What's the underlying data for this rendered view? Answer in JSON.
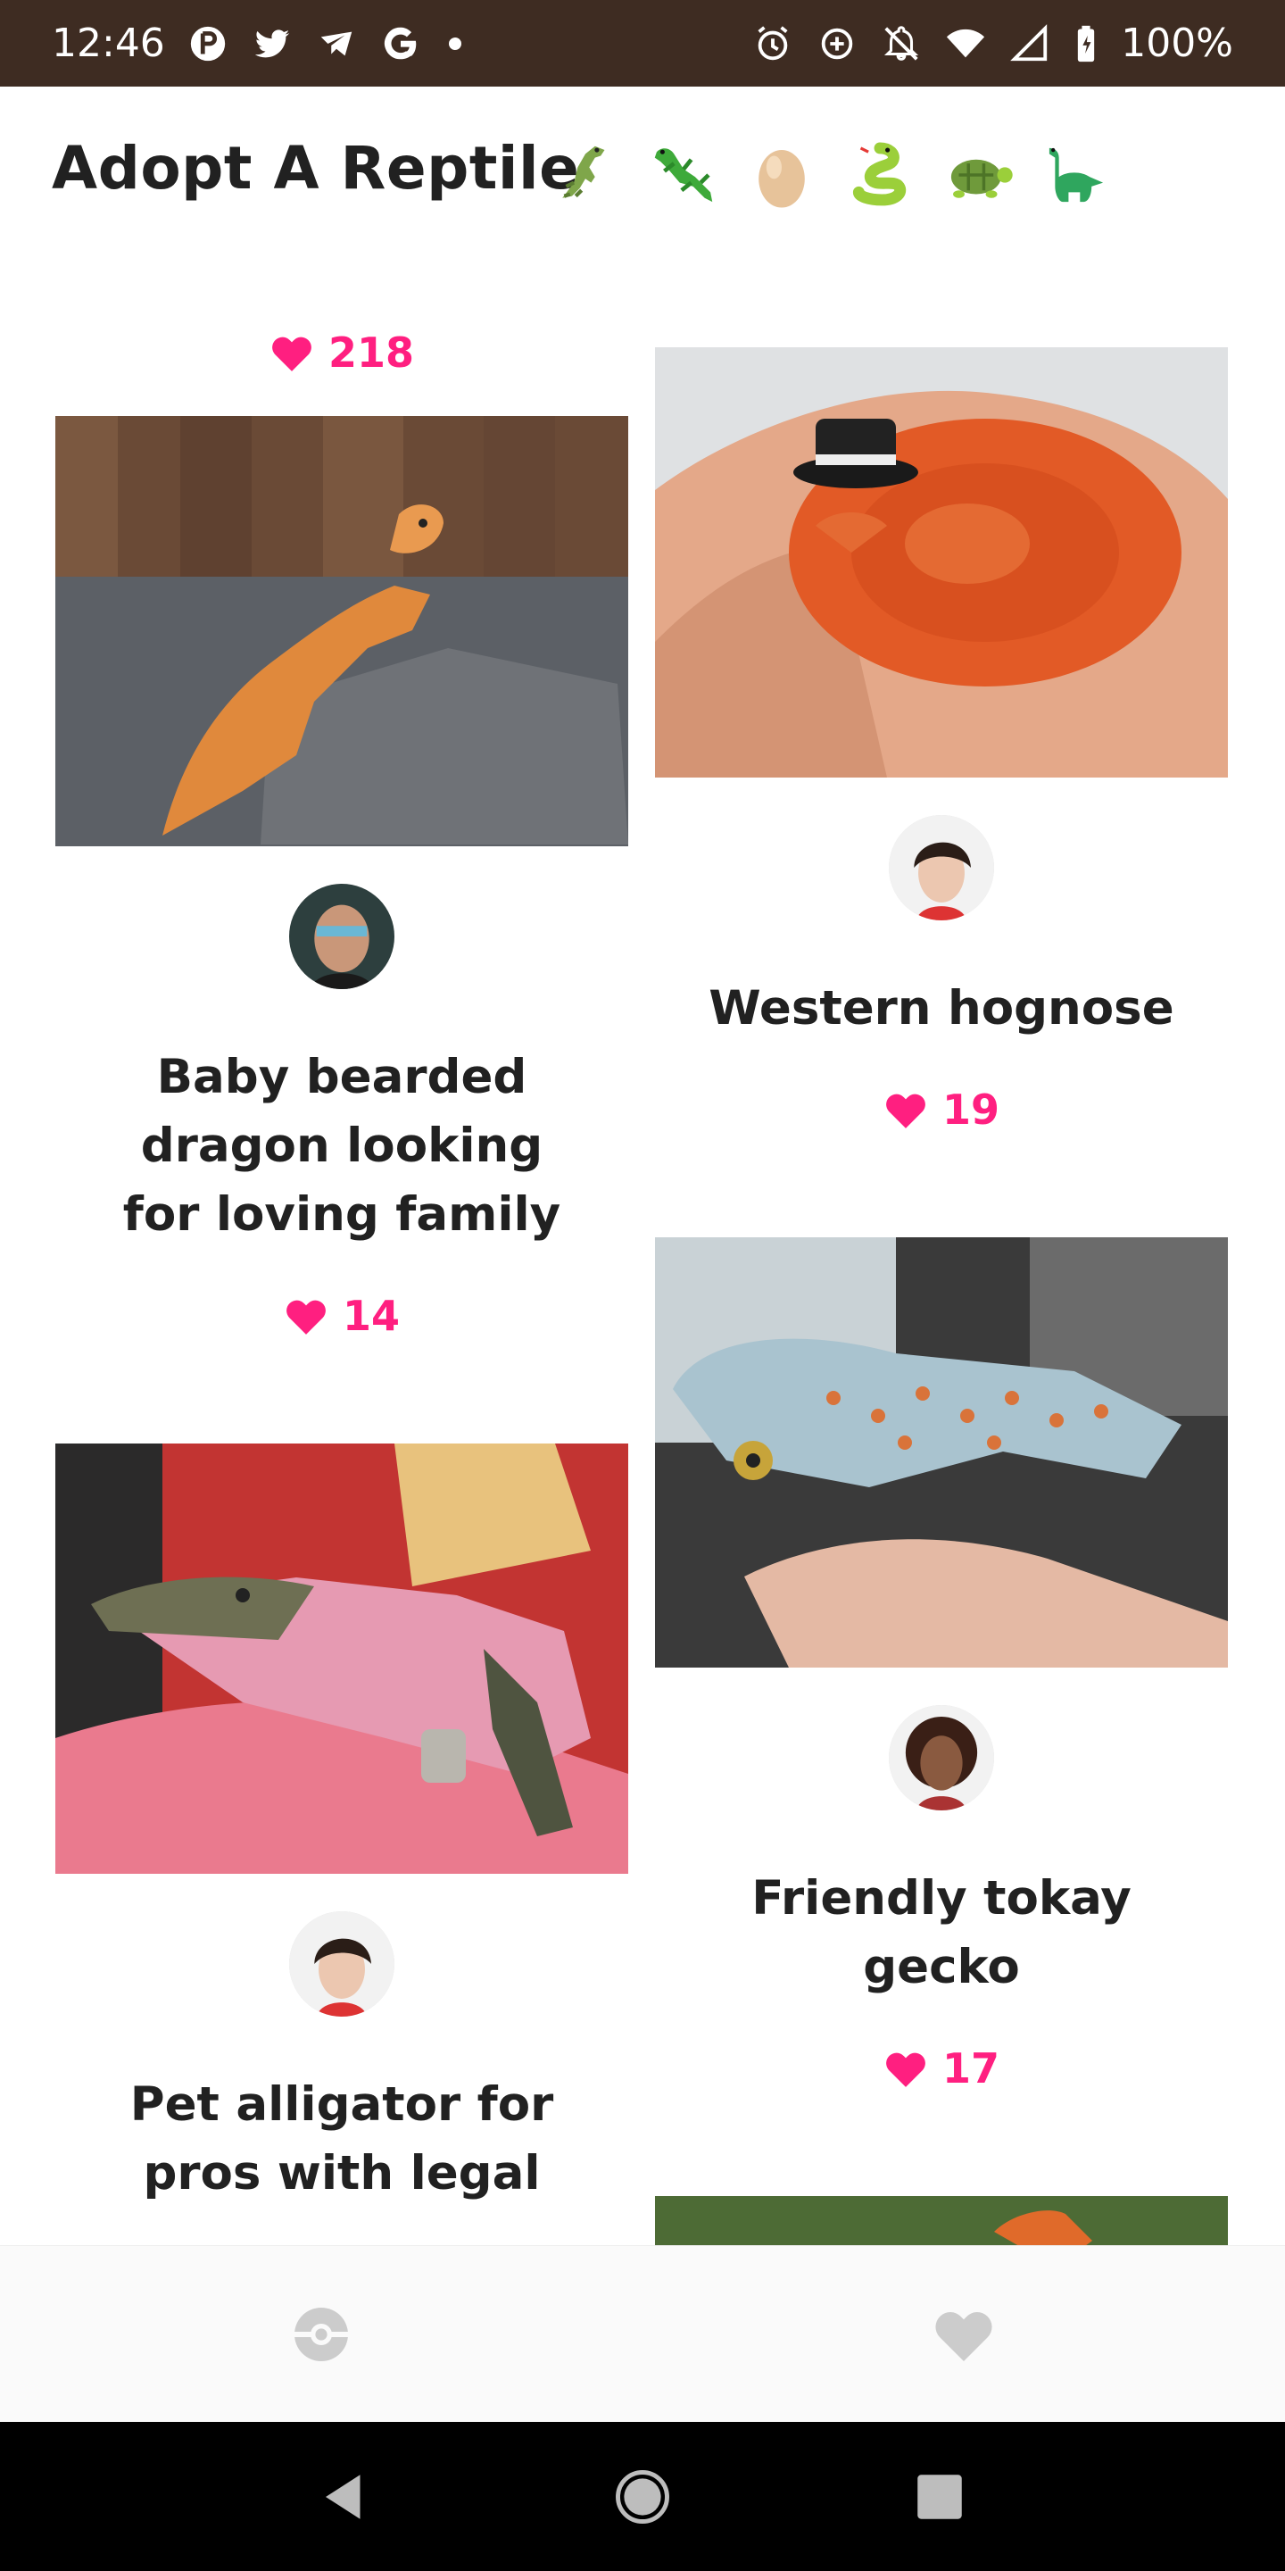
{
  "status_bar": {
    "time": "12:46",
    "battery": "100%",
    "left_icons": [
      "p-icon",
      "twitter-icon",
      "send-icon",
      "google-icon"
    ],
    "right_icons": [
      "alarm-icon",
      "data-saver-icon",
      "bell-off-icon",
      "wifi-icon",
      "signal-icon",
      "battery-icon"
    ]
  },
  "header": {
    "title": "Adopt A Reptile",
    "emojis": [
      "crocodile",
      "lizard",
      "egg",
      "snake",
      "turtle",
      "dinosaur"
    ]
  },
  "feed": {
    "top_likes": "218",
    "cards": [
      {
        "title": "Baby bearded dragon looking for loving family",
        "likes": "14",
        "species": "crocodile",
        "image": "bearded-dragon-photo",
        "avatar": "man-sunglasses-avatar"
      },
      {
        "title": "Western hognose",
        "likes": "19",
        "species": "snake",
        "image": "hognose-snake-photo",
        "avatar": "woman-short-hair-avatar"
      },
      {
        "title": "Pet alligator for pros with legal",
        "likes": "",
        "species": "crocodile",
        "image": "alligator-photo",
        "avatar": "woman-short-hair-avatar"
      },
      {
        "title": "Friendly tokay gecko",
        "likes": "17",
        "species": "lizard",
        "image": "tokay-gecko-photo",
        "avatar": "woman-curly-hair-avatar"
      }
    ]
  },
  "colors": {
    "status_bar_bg": "#3e2c22",
    "like_pink": "#ff1f80",
    "nav_icon": "#cccccc"
  },
  "bottom_nav": {
    "items": [
      "pokeball-icon",
      "heart-icon"
    ]
  },
  "system_nav": {
    "items": [
      "back-icon",
      "home-icon",
      "recents-icon"
    ]
  }
}
